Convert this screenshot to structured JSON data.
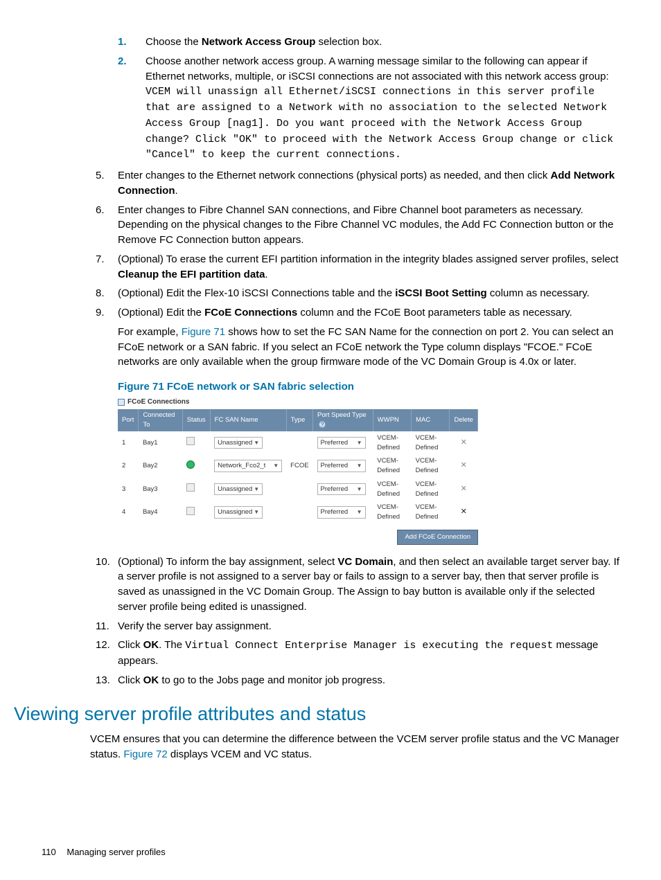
{
  "sub_steps": [
    {
      "n": "1.",
      "html": "Choose the <b>Network Access Group</b> selection box."
    },
    {
      "n": "2.",
      "html": "Choose another network access group. A warning message similar to the following can appear if Ethernet networks, multiple, or iSCSI connections are not associated with this network access group: <span class='mono'>VCEM will unassign all Ethernet/iSCSI connections in this server profile that are assigned to a Network with no association to the selected Network Access Group [nag1]. Do you want proceed with the Network Access Group change? Click \"OK\" to proceed with the Network Access Group change or click \"Cancel\" to keep the current connections.</span>"
    }
  ],
  "steps_a": [
    {
      "n": "5.",
      "html": "Enter changes to the Ethernet network connections (physical ports) as needed, and then click <b>Add Network Connection</b>."
    },
    {
      "n": "6.",
      "html": "Enter changes to Fibre Channel SAN connections, and Fibre Channel boot parameters as necessary. Depending on the physical changes to the Fibre Channel VC modules, the Add FC Connection button or the Remove FC Connection button appears."
    },
    {
      "n": "7.",
      "html": "(Optional) To erase the current EFI partition information in the integrity blades assigned server profiles, select <b>Cleanup the EFI partition data</b>."
    },
    {
      "n": "8.",
      "html": "(Optional) Edit the Flex-10 iSCSI Connections table and the <b>iSCSI Boot Setting</b> column as necessary."
    },
    {
      "n": "9.",
      "html": "(Optional) Edit the <b>FCoE Connections</b> column and the FCoE Boot parameters table as necessary.<div style='height:6px'></div>For example, <span class='link'>Figure 71</span> shows how to set the FC SAN Name for the connection on port 2. You can select an FCoE network or a SAN fabric. If you select an FCoE network the Type column displays \"FCOE.\" FCoE networks are only available when the group firmware mode of the VC Domain Group is 4.0x or later."
    }
  ],
  "figure": {
    "caption": "Figure 71 FCoE network or SAN fabric selection",
    "panel_title": "FCoE Connections",
    "headers": [
      "Port",
      "Connected To",
      "Status",
      "FC SAN Name",
      "Type",
      "Port Speed Type",
      "WWPN",
      "MAC",
      "Delete"
    ],
    "rows": [
      {
        "port": "1",
        "conn": "Bay1",
        "status": "sq",
        "san": "Unassigned",
        "san_wide": false,
        "type": "",
        "speed": "Preferred",
        "wwpn": "VCEM-Defined",
        "mac": "VCEM-Defined",
        "del_dark": false
      },
      {
        "port": "2",
        "conn": "Bay2",
        "status": "grn",
        "san": "Network_Fco2_t",
        "san_wide": true,
        "type": "FCOE",
        "speed": "Preferred",
        "wwpn": "VCEM-Defined",
        "mac": "VCEM-Defined",
        "del_dark": false
      },
      {
        "port": "3",
        "conn": "Bay3",
        "status": "sq",
        "san": "Unassigned",
        "san_wide": false,
        "type": "",
        "speed": "Preferred",
        "wwpn": "VCEM-Defined",
        "mac": "VCEM-Defined",
        "del_dark": false
      },
      {
        "port": "4",
        "conn": "Bay4",
        "status": "sq",
        "san": "Unassigned",
        "san_wide": false,
        "type": "",
        "speed": "Preferred",
        "wwpn": "VCEM-Defined",
        "mac": "VCEM-Defined",
        "del_dark": true
      }
    ],
    "add_btn": "Add FCoE Connection"
  },
  "steps_b": [
    {
      "n": "10.",
      "html": "(Optional) To inform the bay assignment, select <b>VC Domain</b>, and then select an available target server bay. If a server profile is not assigned to a server bay or fails to assign to a server bay, then that server profile is saved as unassigned in the VC Domain Group. The Assign to bay button is available only if the selected server profile being edited is unassigned."
    },
    {
      "n": "11.",
      "html": "Verify the server bay assignment."
    },
    {
      "n": "12.",
      "html": "Click <b>OK</b>. The <span class='mono'>Virtual Connect Enterprise Manager is executing the request</span> message appears."
    },
    {
      "n": "13.",
      "html": "Click <b>OK</b> to go to the Jobs page and monitor job progress."
    }
  ],
  "section_heading": "Viewing server profile attributes and status",
  "section_body_html": "VCEM ensures that you can determine the difference between the VCEM server profile status and the VC Manager status. <span class='link'>Figure 72</span> displays VCEM and VC status.",
  "footer": {
    "page": "110",
    "title": "Managing server profiles"
  }
}
